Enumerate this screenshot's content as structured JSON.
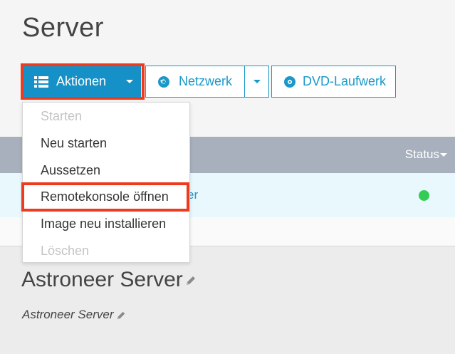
{
  "page": {
    "title": "Server"
  },
  "toolbar": {
    "actions_label": "Aktionen",
    "network_label": "Netzwerk",
    "dvd_label": "DVD-Laufwerk"
  },
  "actions_menu": {
    "items": [
      {
        "label": "Starten",
        "disabled": true
      },
      {
        "label": "Neu starten",
        "disabled": false
      },
      {
        "label": "Aussetzen",
        "disabled": false
      },
      {
        "label": "Remotekonsole öffnen",
        "disabled": false,
        "highlighted": true
      },
      {
        "label": "Image neu installieren",
        "disabled": false
      },
      {
        "label": "Löschen",
        "disabled": true
      }
    ]
  },
  "table": {
    "status_header": "Status",
    "row": {
      "name_suffix": "er",
      "status": "online"
    }
  },
  "details": {
    "name": "Astroneer Server",
    "description": "Astroneer Server"
  },
  "colors": {
    "primary": "#1691c7",
    "highlight": "#ee3a1d",
    "status_online": "#33cc55",
    "header_bg": "#a8b0bd"
  }
}
